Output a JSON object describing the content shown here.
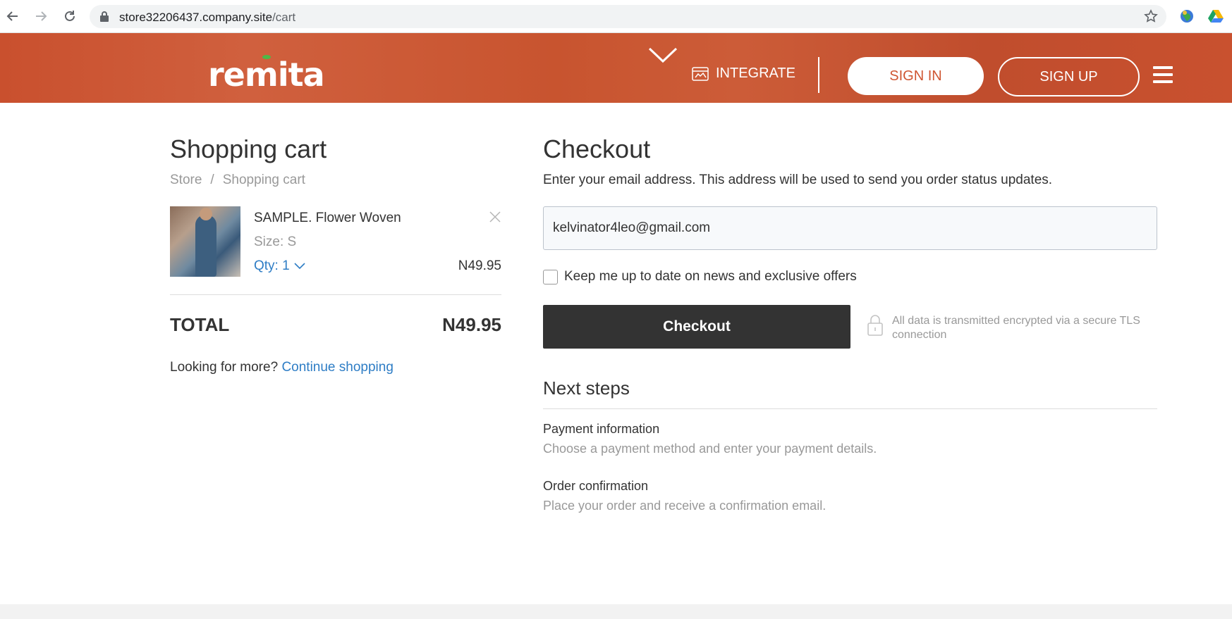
{
  "browser": {
    "url_host": "store32206437.company.site",
    "url_path": "/cart"
  },
  "header": {
    "logo": "remita",
    "integrate_label": "INTEGRATE",
    "signin_label": "SIGN IN",
    "signup_label": "SIGN UP",
    "brand_color": "#c9512f"
  },
  "cart": {
    "title": "Shopping cart",
    "breadcrumb": [
      "Store",
      "/",
      "Shopping cart"
    ],
    "item": {
      "name": "SAMPLE. Flower Woven",
      "size": "Size: S",
      "qty": "Qty: 1",
      "price": "N49.95"
    },
    "total_label": "TOTAL",
    "total_value": "N49.95",
    "more_text": "Looking for more?",
    "continue_link": "Continue shopping"
  },
  "checkout": {
    "title": "Checkout",
    "description": "Enter your email address. This address will be used to send you order status updates.",
    "email_value": "kelvinator4leo@gmail.com",
    "newsletter_label": "Keep me up to date on news and exclusive offers",
    "button_label": "Checkout",
    "secure_text": "All data is transmitted encrypted via a secure TLS connection"
  },
  "next_steps": {
    "title": "Next steps",
    "steps": [
      {
        "title": "Payment information",
        "desc": "Choose a payment method and enter your payment details."
      },
      {
        "title": "Order confirmation",
        "desc": "Place your order and receive a confirmation email."
      }
    ]
  }
}
